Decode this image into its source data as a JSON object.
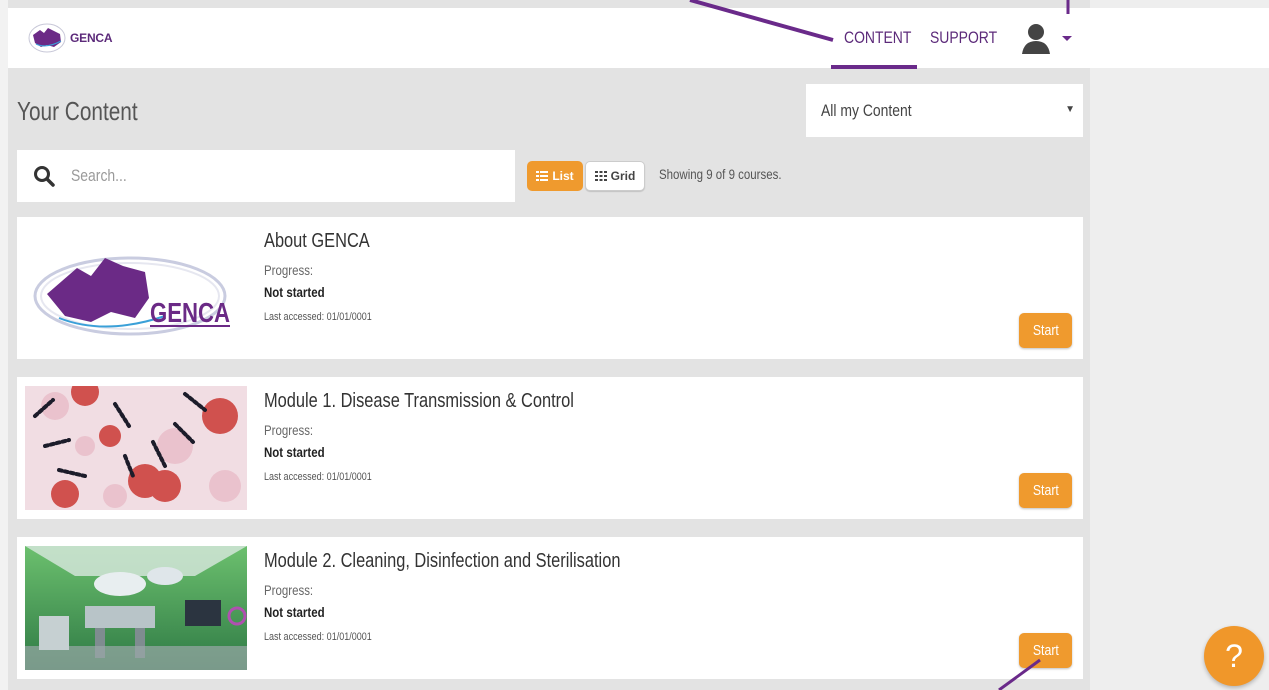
{
  "brand": {
    "logo_text": "GENCA",
    "primary_color": "#5c2a7a",
    "accent_color": "#ef9a2e"
  },
  "nav": {
    "content_label": "CONTENT",
    "support_label": "SUPPORT",
    "active": "CONTENT",
    "user_icon": "user-avatar-icon"
  },
  "page": {
    "title": "Your Content",
    "filter_selected": "All my Content",
    "search_placeholder": "Search...",
    "list_label": "List",
    "grid_label": "Grid",
    "view_mode": "List",
    "showing_text": "Showing 9 of 9 courses."
  },
  "courses": [
    {
      "title": "About GENCA",
      "progress_label": "Progress:",
      "status": "Not started",
      "last_accessed": "Last accessed: 01/01/0001",
      "action": "Start",
      "thumbnail": "genca-logo-image"
    },
    {
      "title": "Module 1. Disease Transmission & Control",
      "progress_label": "Progress:",
      "status": "Not started",
      "last_accessed": "Last accessed: 01/01/0001",
      "action": "Start",
      "thumbnail": "bacteria-microscope-image"
    },
    {
      "title": "Module 2. Cleaning, Disinfection and Sterilisation",
      "progress_label": "Progress:",
      "status": "Not started",
      "last_accessed": "Last accessed: 01/01/0001",
      "action": "Start",
      "thumbnail": "operating-room-image"
    }
  ],
  "help": {
    "label": "?",
    "icon": "help-question-icon"
  }
}
